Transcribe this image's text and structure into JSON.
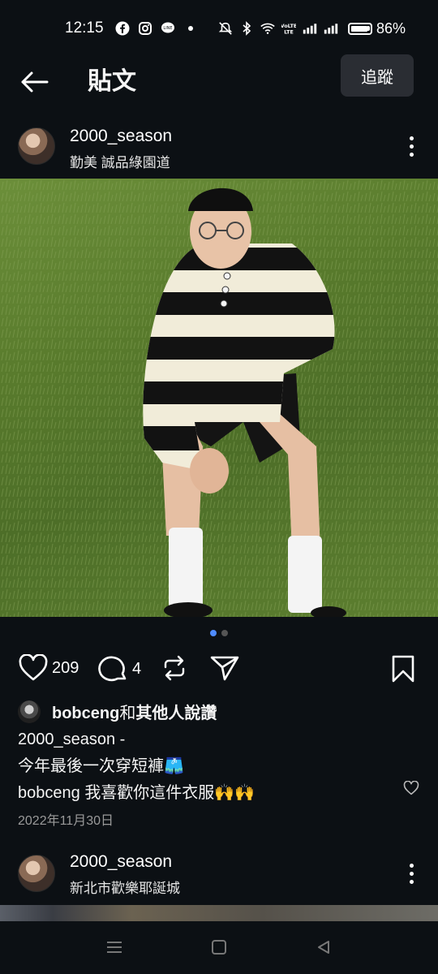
{
  "status_bar": {
    "time": "12:15",
    "battery": "86%",
    "left_icons": [
      "facebook-icon",
      "instagram-icon",
      "line-icon",
      "dot-icon"
    ],
    "right_icons": [
      "mute-icon",
      "bluetooth-icon",
      "wifi-icon",
      "volte-icon",
      "signal-icon",
      "signal-icon",
      "battery-icon"
    ]
  },
  "header": {
    "title": "貼文",
    "follow_label": "追蹤"
  },
  "post": {
    "username": "2000_season",
    "location": "勤美 誠品綠園道",
    "carousel": {
      "count": 2,
      "active": 1
    },
    "likes": "209",
    "comments": "4",
    "liked_by_user": "bobceng",
    "liked_by_joiner": "和",
    "liked_by_suffix": "其他人說讚",
    "caption_user": "2000_season -",
    "caption_text": "今年最後一次穿短褲🩳",
    "comment_user": "bobceng",
    "comment_text": "我喜歡你這件衣服🙌🙌",
    "date": "2022年11月30日"
  },
  "next_post": {
    "username": "2000_season",
    "location": "新北市歡樂耶誕城"
  },
  "colors": {
    "background": "#0c1014",
    "button_bg": "#2a2d33",
    "carousel_active": "#4f8cff",
    "date_text": "#9a9a9a"
  }
}
